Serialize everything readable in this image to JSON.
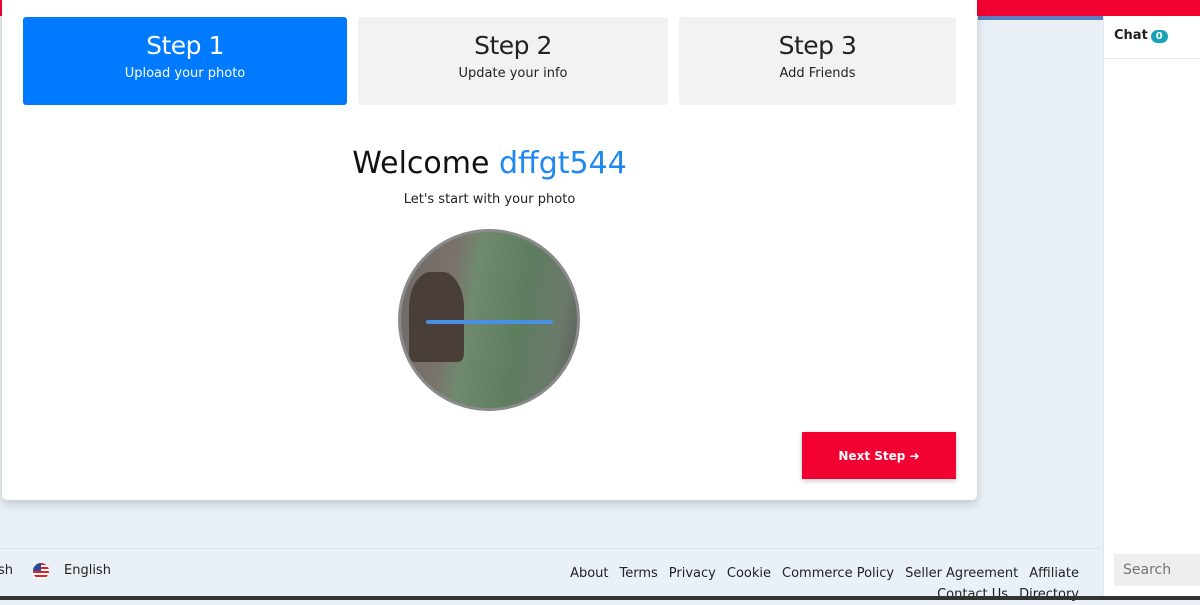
{
  "steps": [
    {
      "title": "Step 1",
      "subtitle": "Upload your photo",
      "active": true
    },
    {
      "title": "Step 2",
      "subtitle": "Update your info",
      "active": false
    },
    {
      "title": "Step 3",
      "subtitle": "Add Friends",
      "active": false
    }
  ],
  "welcome": {
    "prefix": "Welcome",
    "username": "dffgt544",
    "subtitle": "Let's start with your photo"
  },
  "next_button": "Next Step",
  "footer": {
    "language_partial": "sh",
    "language": "English",
    "links": [
      "About",
      "Terms",
      "Privacy",
      "Cookie",
      "Commerce Policy",
      "Seller Agreement",
      "Affiliate",
      "Contact Us",
      "Directory"
    ]
  },
  "chat": {
    "label": "Chat",
    "count": "0",
    "search_placeholder": "Search"
  },
  "colors": {
    "accent": "#f20032",
    "primary": "#007bff"
  }
}
